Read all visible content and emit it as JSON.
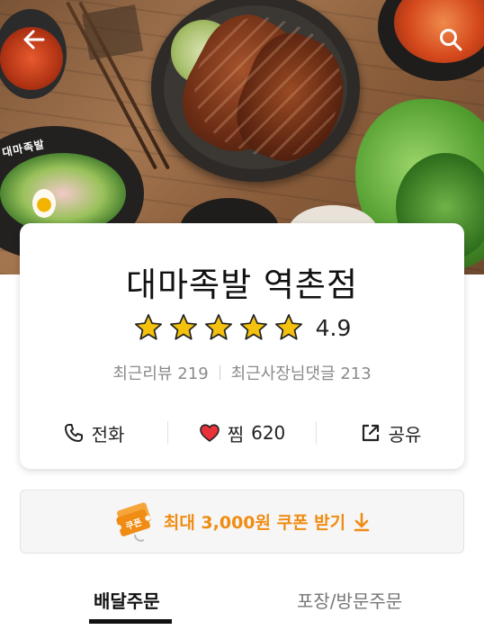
{
  "header": {
    "back_icon": "back-arrow-icon",
    "search_icon": "search-icon"
  },
  "store": {
    "name": "대마족발 역촌점",
    "rating": "4.9",
    "stars": 5,
    "recent_review_label": "최근리뷰",
    "recent_review_count": "219",
    "owner_reply_label": "최근사장님댓글",
    "owner_reply_count": "213"
  },
  "actions": {
    "call_label": "전화",
    "favorite_label": "찜",
    "favorite_count": "620",
    "share_label": "공유"
  },
  "coupon": {
    "text": "최대 3,000원 쿠폰 받기",
    "badge_text": "쿠폰",
    "color": "#f08c13"
  },
  "tabs": [
    {
      "label": "배달주문",
      "active": true
    },
    {
      "label": "포장/방문주문",
      "active": false
    }
  ],
  "hero": {
    "logo_text": "대마족발"
  },
  "colors": {
    "star": "#f4c20d",
    "heart": "#e8333a",
    "accent": "#f08c13"
  }
}
